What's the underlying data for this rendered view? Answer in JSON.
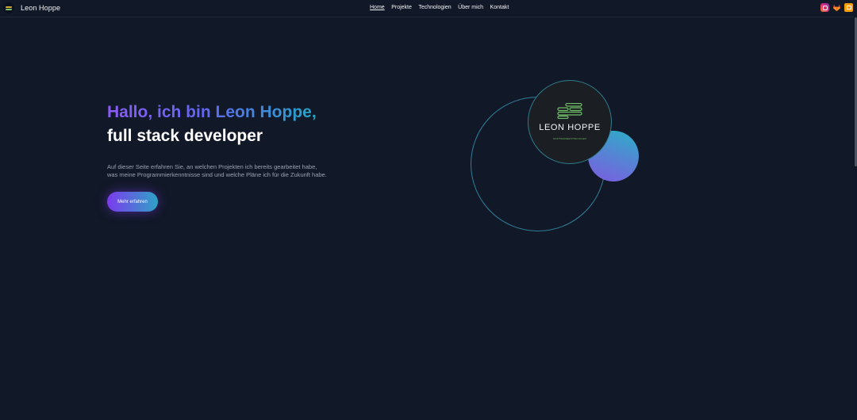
{
  "header": {
    "brand_name": "Leon Hoppe",
    "nav": [
      {
        "label": "Home",
        "active": true
      },
      {
        "label": "Projekte"
      },
      {
        "label": "Technologien"
      },
      {
        "label": "Über mich"
      },
      {
        "label": "Kontakt"
      }
    ],
    "socials": [
      {
        "icon": "instagram-icon"
      },
      {
        "icon": "gitlab-icon"
      },
      {
        "icon": "blog-icon"
      }
    ]
  },
  "hero": {
    "title_line1": "Hallo, ich bin Leon Hoppe,",
    "title_line2": "full stack developer",
    "description_line1": "Auf dieser Seite erfahren Sie, an welchen Projekten ich bereits gearbeitet habe,",
    "description_line2": "was meine Programmierkenntnisse sind und welche Pläne ich für die Zukunft habe.",
    "cta_label": "Mehr erfahren"
  },
  "badge": {
    "name": "LEON HOPPE",
    "tagline": "SOFTWAREENTWICKLER"
  },
  "colors": {
    "background": "#111827",
    "accent_purple": "#8b5cf6",
    "accent_cyan": "#22a7c6",
    "logo_green": "#6fbf6a"
  }
}
